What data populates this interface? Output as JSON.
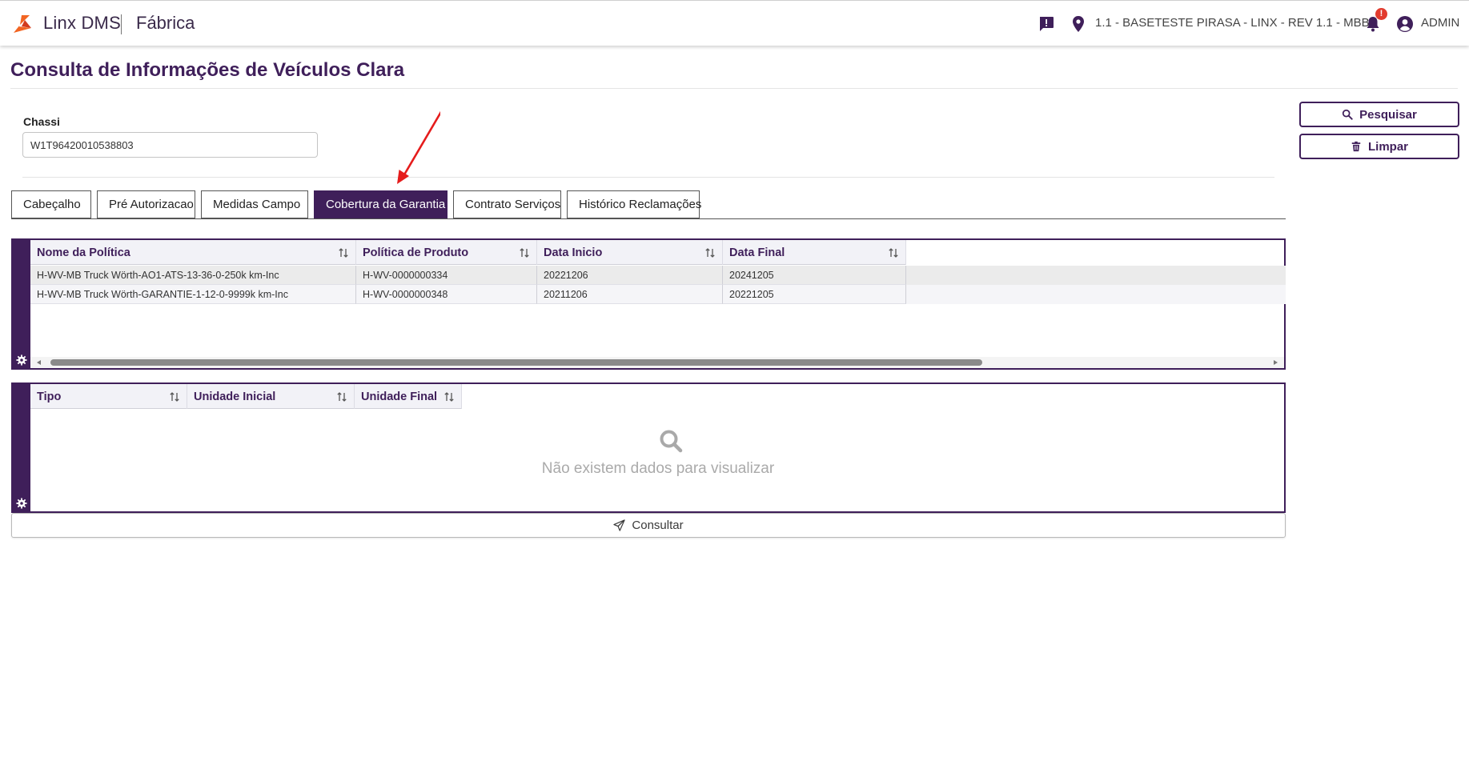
{
  "header": {
    "brand": "Linx DMS",
    "module": "Fábrica",
    "branch": "1.1 - BASETESTE PIRASA - LINX - REV 1.1 - MBB",
    "notification_count": "!",
    "user": "ADMIN"
  },
  "page": {
    "title": "Consulta de Informações de Veículos Clara"
  },
  "form": {
    "chassi_label": "Chassi",
    "chassi_value": "W1T96420010538803"
  },
  "actions": {
    "search_label": "Pesquisar",
    "clear_label": "Limpar",
    "consult_label": "Consultar"
  },
  "tabs": [
    {
      "label": "Cabeçalho",
      "active": false
    },
    {
      "label": "Pré Autorizacao",
      "active": false
    },
    {
      "label": "Medidas Campo",
      "active": false
    },
    {
      "label": "Cobertura da Garantia",
      "active": true
    },
    {
      "label": "Contrato Serviços",
      "active": false
    },
    {
      "label": "Histórico Reclamações",
      "active": false
    }
  ],
  "policy_grid": {
    "columns": [
      "Nome da Política",
      "Política de Produto",
      "Data Inicio",
      "Data Final"
    ],
    "rows": [
      [
        "H-WV-MB Truck Wörth-AO1-ATS-13-36-0-250k km-Inc",
        "H-WV-0000000334",
        "20221206",
        "20241205"
      ],
      [
        "H-WV-MB Truck Wörth-GARANTIE-1-12-0-9999k km-Inc",
        "H-WV-0000000348",
        "20211206",
        "20221205"
      ]
    ]
  },
  "units_grid": {
    "columns": [
      "Tipo",
      "Unidade Inicial",
      "Unidade Final"
    ],
    "empty_message": "Não existem dados para visualizar"
  },
  "icons": {
    "logo": "linx-logo-icon",
    "chat": "chat-icon",
    "location": "location-pin-icon",
    "bell": "bell-icon",
    "user": "user-circle-icon",
    "search": "search-icon",
    "trash": "trash-icon",
    "gear": "gear-icon",
    "sort": "sort-icon",
    "send": "send-icon"
  },
  "colors": {
    "primary": "#3f1f5a",
    "accent": "#e23b2e",
    "logo_orange": "#f26522"
  }
}
